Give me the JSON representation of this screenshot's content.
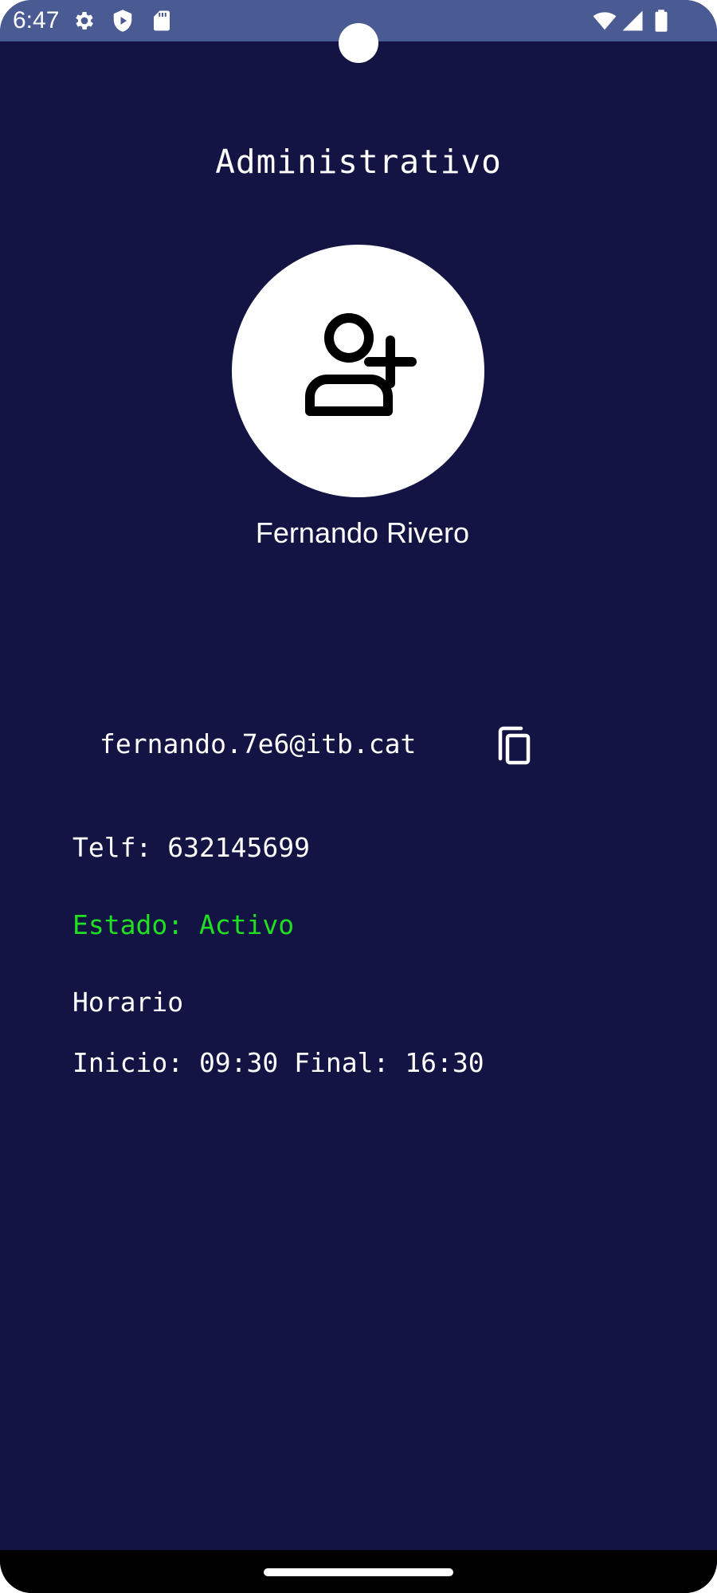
{
  "status_bar": {
    "time": "6:47",
    "left_icons": [
      "gear-icon",
      "shield-icon",
      "sd-card-icon"
    ],
    "right_icons": [
      "wifi-icon",
      "cell-signal-icon",
      "battery-icon"
    ]
  },
  "profile": {
    "role": "Administrativo",
    "avatar_icon": "add-user-icon",
    "name": "Fernando Rivero"
  },
  "contact": {
    "email": "fernando.7e6@itb.cat",
    "copy_icon": "copy-icon",
    "phone": "Telf: 632145699",
    "status": "Estado: Activo",
    "status_color": "#21e021"
  },
  "schedule": {
    "label": "Horario",
    "times": "Inicio: 09:30 Final: 16:30"
  },
  "colors": {
    "background": "#131344",
    "status_bar": "#4a5a93"
  }
}
